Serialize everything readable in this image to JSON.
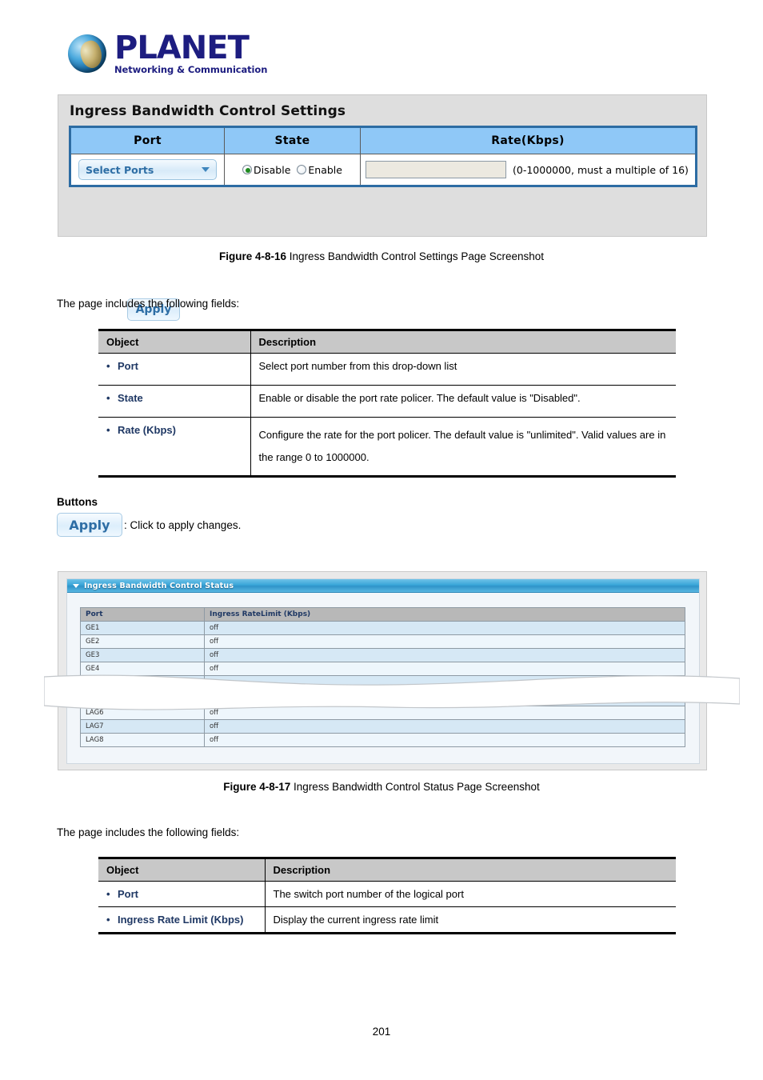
{
  "logo": {
    "brand": "PLANET",
    "tagline": "Networking & Communication"
  },
  "settings_panel": {
    "title": "Ingress Bandwidth Control Settings",
    "columns": [
      "Port",
      "State",
      "Rate(Kbps)"
    ],
    "port_select": {
      "value": "Select Ports",
      "icon": "chevron-down-icon"
    },
    "state": {
      "options": [
        "Disable",
        "Enable"
      ],
      "selected": "Disable"
    },
    "rate": {
      "value": "",
      "hint": "(0-1000000, must a multiple of 16)"
    },
    "apply_label": "Apply"
  },
  "figure1": {
    "number": "Figure 4-8-16",
    "caption": "Ingress Bandwidth Control Settings Page Screenshot"
  },
  "intro_text_1": "The page includes the following fields:",
  "fields_table_1": {
    "headers": [
      "Object",
      "Description"
    ],
    "rows": [
      {
        "object": "Port",
        "description": "Select port number from this drop-down list"
      },
      {
        "object": "State",
        "description": "Enable or disable the port rate policer. The default value is \"Disabled\"."
      },
      {
        "object": "Rate (Kbps)",
        "description": "Configure the rate for the port policer. The default value is \"unlimited\". Valid values are in the range 0 to 1000000."
      }
    ]
  },
  "buttons_section": {
    "heading": "Buttons",
    "apply_label": "Apply",
    "apply_description": ": Click to apply changes."
  },
  "status_panel": {
    "title": "Ingress Bandwidth Control Status",
    "collapse_icon": "triangle-down-icon",
    "columns": [
      "Port",
      "Ingress RateLimit (Kbps)"
    ],
    "rows_top": [
      {
        "port": "GE1",
        "limit": "off"
      },
      {
        "port": "GE2",
        "limit": "off"
      },
      {
        "port": "GE3",
        "limit": "off"
      },
      {
        "port": "GE4",
        "limit": "off"
      }
    ],
    "rows_bottom": [
      {
        "port": "LAG6",
        "limit": "off"
      },
      {
        "port": "LAG7",
        "limit": "off"
      },
      {
        "port": "LAG8",
        "limit": "off"
      }
    ]
  },
  "figure2": {
    "number": "Figure 4-8-17",
    "caption": "Ingress Bandwidth Control Status Page Screenshot"
  },
  "intro_text_2": "The page includes the following fields:",
  "fields_table_2": {
    "headers": [
      "Object",
      "Description"
    ],
    "rows": [
      {
        "object": "Port",
        "description": "The switch port number of the logical port"
      },
      {
        "object": "Ingress Rate Limit (Kbps)",
        "description": "Display the current ingress rate limit"
      }
    ]
  },
  "page_number": "201",
  "colors": {
    "header_blue": "#8fc8f7",
    "table_border_blue": "#2d6ca3",
    "object_text": "#1f3864",
    "panel_bg": "#dedede",
    "status_header_gray": "#b8b8b8",
    "row_alt": "#d6e8f5",
    "row_norm": "#eef6fc"
  }
}
